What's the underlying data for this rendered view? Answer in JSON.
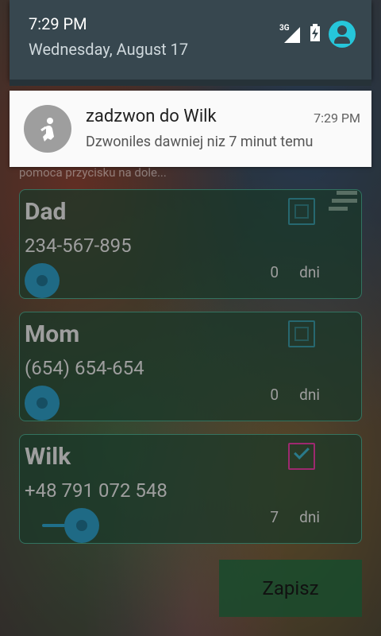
{
  "status_shade": {
    "time": "7:29 PM",
    "date": "Wednesday, August 17",
    "network": "3G"
  },
  "notification": {
    "title": "zadzwon do Wilk",
    "time": "7:29 PM",
    "message": "Dzwoniles dawniej niz 7 minut temu"
  },
  "hint_text": "pomoca przycisku na dole...",
  "contacts": [
    {
      "name": "Dad",
      "phone": "234-567-895",
      "days": "0",
      "unit": "dni",
      "checked": false,
      "slider_fraction": 0.0
    },
    {
      "name": "Mom",
      "phone": "(654) 654-654",
      "days": "0",
      "unit": "dni",
      "checked": false,
      "slider_fraction": 0.0
    },
    {
      "name": "Wilk",
      "phone": "+48 791 072 548",
      "days": "7",
      "unit": "dni",
      "checked": true,
      "slider_fraction": 0.2
    }
  ],
  "save_button": {
    "label": "Zapisz"
  },
  "colors": {
    "shade_bg": "#37474f",
    "avatar": "#26c6da",
    "card_border": "#3c8c78",
    "slider": "#1f6a85"
  }
}
